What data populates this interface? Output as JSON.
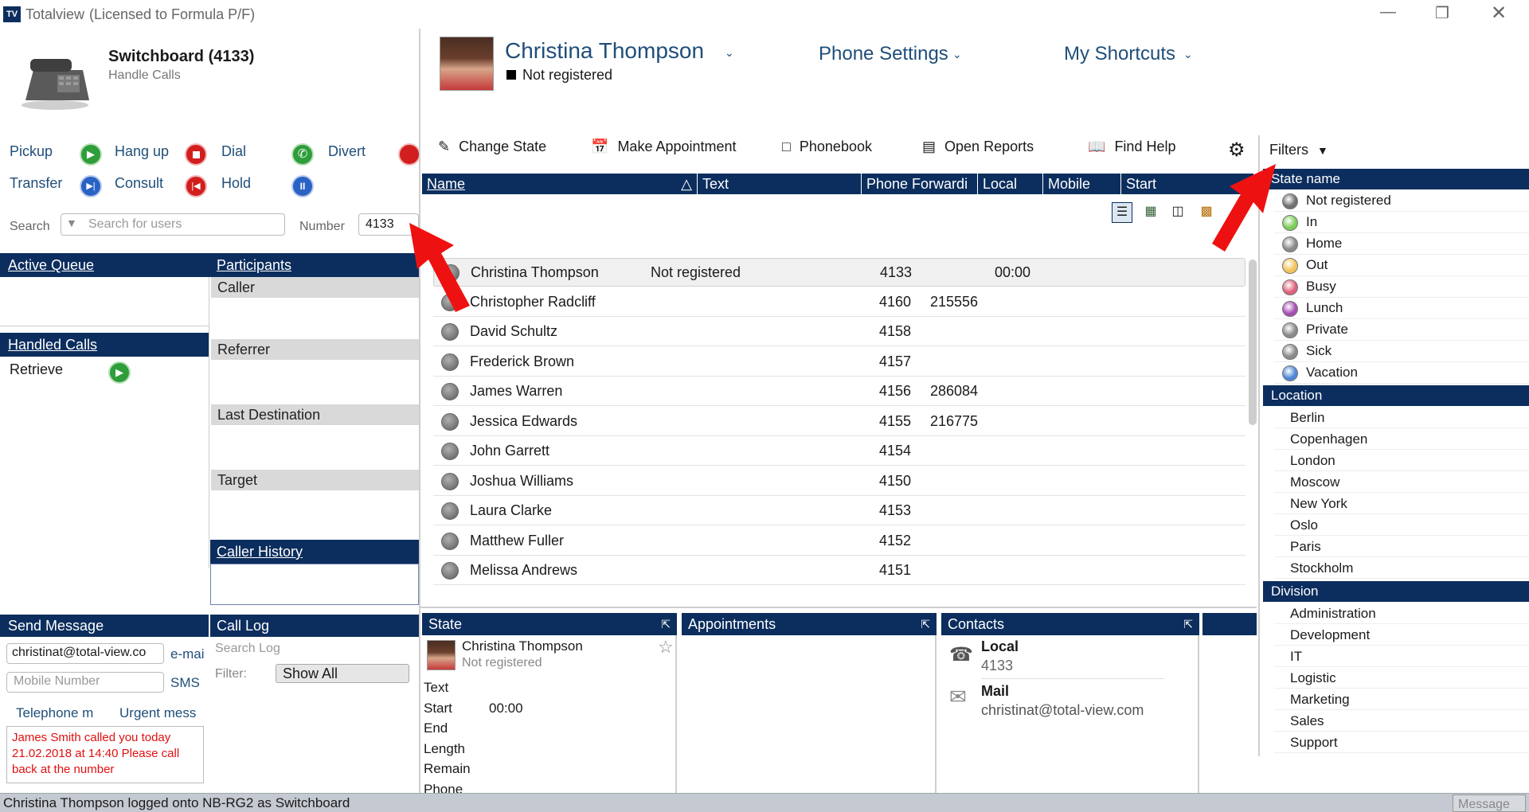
{
  "window": {
    "app_badge": "TV",
    "title": "Totalview",
    "license": "(Licensed to Formula P/F)"
  },
  "switchboard": {
    "title": "Switchboard (4133)",
    "subtitle": "Handle Calls"
  },
  "call_actions": [
    {
      "label": "Pickup",
      "color": "#2e9d3a",
      "icon": "play-icon"
    },
    {
      "label": "Hang up",
      "color": "#d21e1e",
      "icon": "stop-icon"
    },
    {
      "label": "Dial",
      "color": "#2e9d3a",
      "icon": "dial-icon"
    },
    {
      "label": "Divert",
      "color": "#d21e1e",
      "icon": "divert-icon"
    },
    {
      "label": "Transfer",
      "color": "#2a62c4",
      "icon": "skip-icon"
    },
    {
      "label": "Consult",
      "color": "#d21e1e",
      "icon": "rewind-icon"
    },
    {
      "label": "Hold",
      "color": "#2a62c4",
      "icon": "pause-icon"
    }
  ],
  "search": {
    "label": "Search",
    "placeholder": "Search for users",
    "number_label": "Number",
    "number_value": "4133"
  },
  "active_queue": {
    "title": "Active Queue"
  },
  "handled_calls": {
    "title": "Handled Calls",
    "retrieve_label": "Retrieve"
  },
  "participants": {
    "title": "Participants",
    "sections": [
      "Caller",
      "Referrer",
      "Last Destination",
      "Target"
    ],
    "caller_history": "Caller History"
  },
  "send_message": {
    "title": "Send Message",
    "email_value": "christinat@total-view.co",
    "email_btn": "e-mai",
    "mobile_placeholder": "Mobile Number",
    "sms_btn": "SMS",
    "telephone_msg": "Telephone m",
    "urgent_msg": "Urgent mess",
    "message_text": "James Smith called you today 21.02.2018 at 14:40 Please call back at the number"
  },
  "call_log": {
    "title": "Call Log",
    "search_placeholder": "Search Log",
    "filter_label": "Filter:",
    "filter_value": "Show All"
  },
  "profile": {
    "name": "Christina Thompson",
    "status": "Not registered",
    "phone_settings": "Phone Settings",
    "my_shortcuts": "My Shortcuts"
  },
  "toolbar": [
    {
      "label": "Change State",
      "icon": "person-state-icon"
    },
    {
      "label": "Make Appointment",
      "icon": "calendar-icon"
    },
    {
      "label": "Phonebook",
      "icon": "phonebook-icon"
    },
    {
      "label": "Open Reports",
      "icon": "reports-icon"
    },
    {
      "label": "Find Help",
      "icon": "book-icon"
    }
  ],
  "table": {
    "columns": [
      "Name",
      "Text",
      "Phone Forwardi",
      "Local",
      "Mobile",
      "Start"
    ],
    "rows": [
      {
        "name": "Christina Thompson",
        "text": "Not registered",
        "local": "4133",
        "mobile": "",
        "start": "00:00"
      },
      {
        "name": "Christopher Radcliff",
        "text": "",
        "local": "4160",
        "mobile": "215556",
        "start": ""
      },
      {
        "name": "David Schultz",
        "text": "",
        "local": "4158",
        "mobile": "",
        "start": ""
      },
      {
        "name": "Frederick Brown",
        "text": "",
        "local": "4157",
        "mobile": "",
        "start": ""
      },
      {
        "name": "James Warren",
        "text": "",
        "local": "4156",
        "mobile": "286084",
        "start": ""
      },
      {
        "name": "Jessica Edwards",
        "text": "",
        "local": "4155",
        "mobile": "216775",
        "start": ""
      },
      {
        "name": "John Garrett",
        "text": "",
        "local": "4154",
        "mobile": "",
        "start": ""
      },
      {
        "name": "Joshua Williams",
        "text": "",
        "local": "4150",
        "mobile": "",
        "start": ""
      },
      {
        "name": "Laura Clarke",
        "text": "",
        "local": "4153",
        "mobile": "",
        "start": ""
      },
      {
        "name": "Matthew Fuller",
        "text": "",
        "local": "4152",
        "mobile": "",
        "start": ""
      },
      {
        "name": "Melissa Andrews",
        "text": "",
        "local": "4151",
        "mobile": "",
        "start": ""
      }
    ]
  },
  "state_panel": {
    "title": "State",
    "name": "Christina Thompson",
    "status": "Not registered",
    "fields": [
      {
        "label": "Text",
        "value": ""
      },
      {
        "label": "Start",
        "value": "00:00"
      },
      {
        "label": "End",
        "value": ""
      },
      {
        "label": "Length",
        "value": ""
      },
      {
        "label": "Remain",
        "value": ""
      },
      {
        "label": "Phone",
        "value": ""
      }
    ]
  },
  "appointments": {
    "title": "Appointments"
  },
  "contacts": {
    "title": "Contacts",
    "local_label": "Local",
    "local_value": "4133",
    "mail_label": "Mail",
    "mail_value": "christinat@total-view.com"
  },
  "filters": {
    "title": "Filters",
    "state_header": "State name",
    "states": [
      {
        "label": "Not registered",
        "color": "#6f6f6f"
      },
      {
        "label": "In",
        "color": "#7ccd58"
      },
      {
        "label": "Home",
        "color": "#8a8a8a"
      },
      {
        "label": "Out",
        "color": "#f2c45a"
      },
      {
        "label": "Busy",
        "color": "#e0607a"
      },
      {
        "label": "Lunch",
        "color": "#a64db3"
      },
      {
        "label": "Private",
        "color": "#8a8a8a"
      },
      {
        "label": "Sick",
        "color": "#8a8a8a"
      },
      {
        "label": "Vacation",
        "color": "#4f87d6"
      }
    ],
    "location_header": "Location",
    "locations": [
      "Berlin",
      "Copenhagen",
      "London",
      "Moscow",
      "New York",
      "Oslo",
      "Paris",
      "Stockholm"
    ],
    "division_header": "Division",
    "divisions": [
      "Administration",
      "Development",
      "IT",
      "Logistic",
      "Marketing",
      "Sales",
      "Support"
    ]
  },
  "statusbar": {
    "text": "Christina Thompson logged onto NB-RG2 as Switchboard",
    "message": "Message"
  }
}
